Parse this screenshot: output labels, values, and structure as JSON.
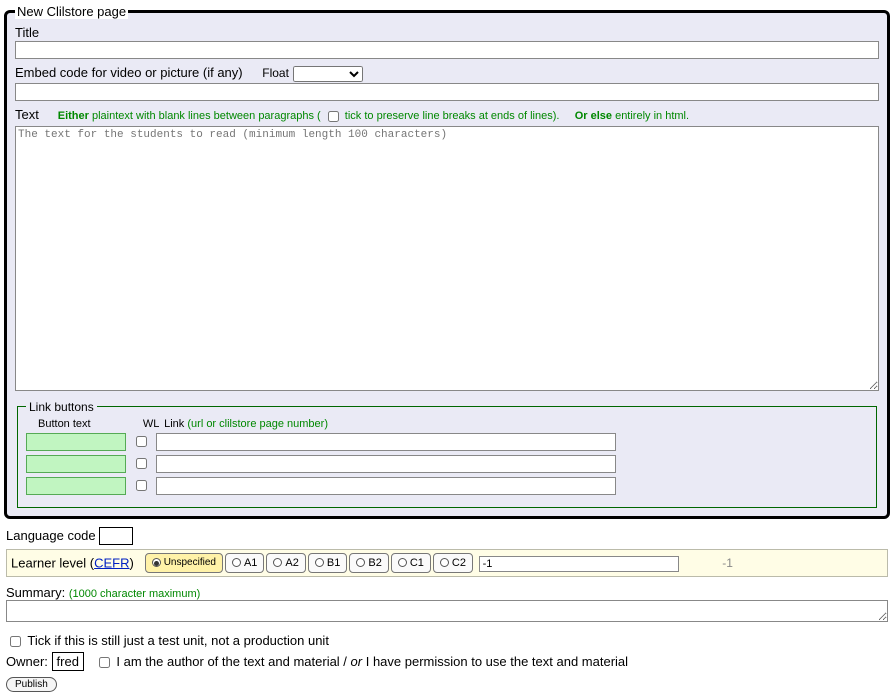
{
  "fieldset_legend": "New Clilstore page",
  "title": {
    "label": "Title",
    "value": ""
  },
  "embed": {
    "label": "Embed code for video or picture (if any)",
    "value": "",
    "float_label": "Float",
    "float_options": [
      ""
    ]
  },
  "text": {
    "label": "Text",
    "hint_either": "Either",
    "hint_plain": " plaintext with blank lines between paragraphs ( ",
    "hint_tick": " tick to preserve line breaks at ends of lines).",
    "hint_orelse": "Or else",
    "hint_html": " entirely in html.",
    "placeholder": "The text for the students to read (minimum length 100 characters)",
    "value": ""
  },
  "link_buttons": {
    "legend": "Link buttons",
    "col_button_text": "Button text",
    "col_wl": "WL",
    "col_link": "Link",
    "col_link_hint": "(url or clilstore page number)",
    "rows": [
      {
        "button_text": "",
        "wl": false,
        "link": ""
      },
      {
        "button_text": "",
        "wl": false,
        "link": ""
      },
      {
        "button_text": "",
        "wl": false,
        "link": ""
      }
    ]
  },
  "lang_code": {
    "label": "Language code",
    "value": ""
  },
  "cefr": {
    "label_pre": "Learner level (",
    "label_link": "CEFR",
    "label_post": ")",
    "levels": [
      "Unspecified",
      "A1",
      "A2",
      "B1",
      "B2",
      "C1",
      "C2"
    ],
    "selected": "Unspecified",
    "numeric_value": "-1",
    "numeric_echo": "-1"
  },
  "summary": {
    "label": "Summary:",
    "hint": "(1000 character maximum)",
    "value": ""
  },
  "test_unit": {
    "label": "Tick if this is still just a test unit, not a production unit",
    "checked": false
  },
  "owner": {
    "label": "Owner:",
    "name": "fred",
    "perm_label_pre": "I am the author of the text and material / ",
    "perm_label_italic": "or",
    "perm_label_post": " I have permission to use the text and material",
    "perm_checked": false
  },
  "publish_label": "Publish"
}
